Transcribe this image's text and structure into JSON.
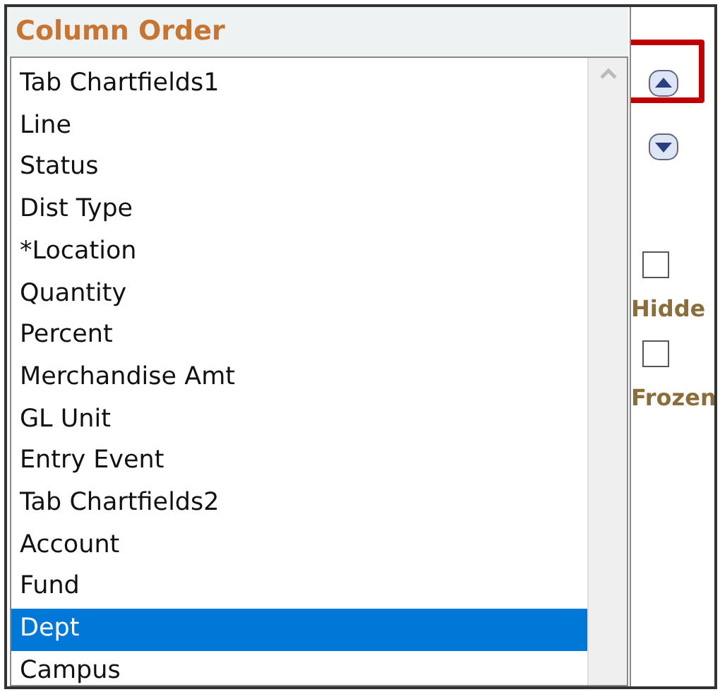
{
  "title": "Column Order",
  "columns": [
    {
      "label": "Tab Chartfields1",
      "selected": false
    },
    {
      "label": "Line",
      "selected": false
    },
    {
      "label": "Status",
      "selected": false
    },
    {
      "label": "Dist Type",
      "selected": false
    },
    {
      "label": "*Location",
      "selected": false
    },
    {
      "label": "Quantity",
      "selected": false
    },
    {
      "label": "Percent",
      "selected": false
    },
    {
      "label": "Merchandise Amt",
      "selected": false
    },
    {
      "label": "GL Unit",
      "selected": false
    },
    {
      "label": "Entry Event",
      "selected": false
    },
    {
      "label": "Tab Chartfields2",
      "selected": false
    },
    {
      "label": "Account",
      "selected": false
    },
    {
      "label": "Fund",
      "selected": false
    },
    {
      "label": "Dept",
      "selected": true
    },
    {
      "label": "Campus",
      "selected": false
    }
  ],
  "options": [
    {
      "label": "Hidde",
      "checked": false
    },
    {
      "label": "Frozen",
      "checked": false
    }
  ]
}
